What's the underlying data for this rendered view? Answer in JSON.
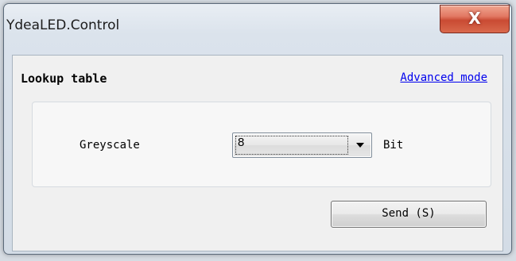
{
  "window": {
    "title": "YdeaLED.Control",
    "close_label": "X"
  },
  "section": {
    "title": "Lookup table",
    "advanced_link": "Advanced mode"
  },
  "greyscale": {
    "label": "Greyscale",
    "selected": "8",
    "unit": "Bit"
  },
  "actions": {
    "send_label": "Send (S)"
  },
  "colors": {
    "link": "#0000ee",
    "close_button": "#c94a33"
  }
}
